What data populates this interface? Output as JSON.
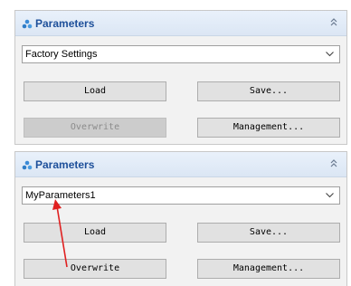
{
  "panels": [
    {
      "title": "Parameters",
      "selected_parameter": "Factory Settings",
      "buttons": {
        "load": "Load",
        "save": "Save...",
        "overwrite": "Overwrite",
        "management": "Management..."
      },
      "overwrite_enabled": false
    },
    {
      "title": "Parameters",
      "selected_parameter": "MyParameters1",
      "buttons": {
        "load": "Load",
        "save": "Save...",
        "overwrite": "Overwrite",
        "management": "Management..."
      },
      "overwrite_enabled": true
    }
  ],
  "icons": {
    "panel_icon": "parameters-icon",
    "collapse_icon": "collapse-chevron-icon",
    "dropdown_icon": "chevron-down-icon"
  },
  "colors": {
    "title_text": "#1d4f9a",
    "header_background": "#dbe6f4",
    "panel_background": "#f2f2f2",
    "button_background": "#e1e1e1",
    "disabled_button_background": "#cccccc",
    "annotation_arrow": "#e02020"
  }
}
